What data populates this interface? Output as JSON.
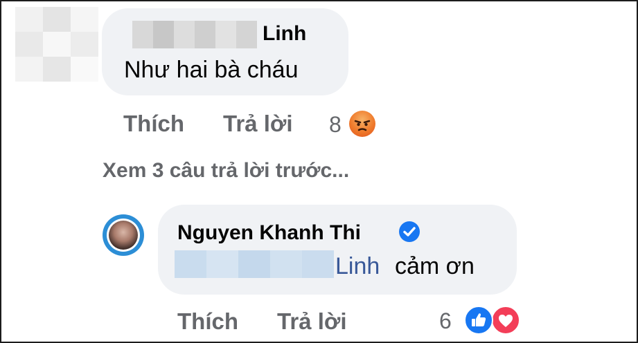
{
  "comment1": {
    "name_visible": "Linh",
    "text": "Như hai bà cháu",
    "actions": {
      "like": "Thích",
      "reply": "Trả lời"
    },
    "reaction_count": "8",
    "reaction_icon": "angry-icon"
  },
  "view_previous": "Xem 3 câu trả lời trước...",
  "reply1": {
    "author": "Nguyen Khanh Thi",
    "verified_icon": "verified-badge-icon",
    "mention": "Linh",
    "text": "cảm ơn",
    "actions": {
      "like": "Thích",
      "reply": "Trả lời"
    },
    "reaction_count": "6",
    "reaction_icons": [
      "like-icon",
      "love-icon"
    ]
  },
  "colors": {
    "bubble_bg": "#f0f2f5",
    "action_text": "#65676b",
    "mention": "#385898",
    "verified": "#1877f2",
    "love": "#f33e58"
  }
}
